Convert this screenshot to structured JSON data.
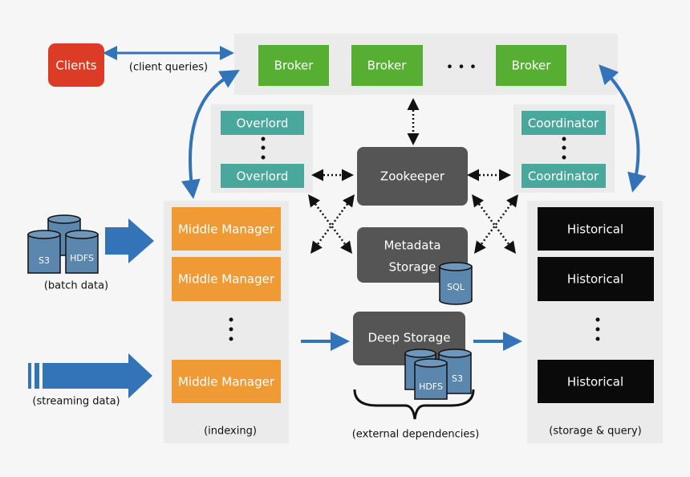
{
  "colors": {
    "background": "#f6f6f6",
    "panel": "#ebebeb",
    "clients": "#dc3b26",
    "broker": "#56ae32",
    "overlord": "#4aa79c",
    "coordinator": "#4aa79c",
    "middle_manager": "#f09a36",
    "historical": "#0a0a0a",
    "external": "#555555",
    "arrow": "#3373b8",
    "cylinder": "#5b86ad"
  },
  "clients": {
    "label": "Clients",
    "query_label": "(client queries)"
  },
  "brokers": {
    "items": [
      "Broker",
      "Broker",
      "Broker"
    ],
    "ellipsis": "• • •"
  },
  "overlords": {
    "items": [
      "Overlord",
      "Overlord"
    ]
  },
  "coordinators": {
    "items": [
      "Coordinator",
      "Coordinator"
    ]
  },
  "external": {
    "zookeeper": "Zookeeper",
    "metadata_line1": "Metadata",
    "metadata_line2": "Storage",
    "metadata_db": "SQL",
    "deep_storage": "Deep Storage",
    "deep_cyl1": "HDFS",
    "deep_cyl2": "S3",
    "caption": "(external dependencies)"
  },
  "indexing": {
    "items": [
      "Middle Manager",
      "Middle Manager",
      "Middle Manager"
    ],
    "caption": "(indexing)"
  },
  "historicals": {
    "items": [
      "Historical",
      "Historical",
      "Historical"
    ],
    "caption": "(storage & query)"
  },
  "batch": {
    "cyl1": "S3",
    "cyl2": "HDFS",
    "caption": "(batch data)"
  },
  "streaming": {
    "caption": "(streaming data)"
  }
}
